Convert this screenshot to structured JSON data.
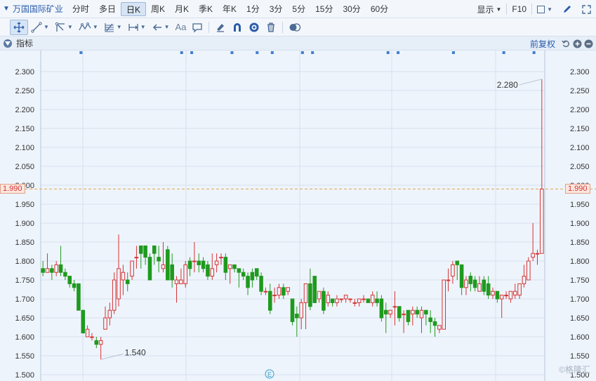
{
  "toolbar": {
    "stock_name": "万国国际矿业",
    "periods": [
      "分时",
      "多日",
      "日K",
      "周K",
      "月K",
      "季K",
      "年K",
      "1分",
      "3分",
      "5分",
      "15分",
      "30分",
      "60分"
    ],
    "active_period": "日K",
    "display_label": "显示",
    "f10_label": "F10"
  },
  "drawing_tools": {
    "text_tool_label": "Aa"
  },
  "indicator_bar": {
    "label": "指标",
    "adjust_label": "前复权"
  },
  "watermark": "©格隆汇",
  "colors": {
    "up": "#d53333",
    "down": "#1e9a1e",
    "accent": "#2a5caa",
    "current_line": "#e3a34a"
  },
  "chart_data": {
    "type": "candlestick",
    "y_ticks": [
      "2.300",
      "2.250",
      "2.200",
      "2.150",
      "2.100",
      "2.050",
      "2.000",
      "1.950",
      "1.900",
      "1.850",
      "1.800",
      "1.750",
      "1.700",
      "1.650",
      "1.600",
      "1.550",
      "1.500"
    ],
    "ylim": [
      1.5,
      2.3
    ],
    "current_price": 1.99,
    "current_price_label": "1.990",
    "annotations": [
      {
        "text": "2.280",
        "value": 2.28,
        "candle_index": 124
      },
      {
        "text": "1.540",
        "value": 1.54,
        "candle_index": 13
      }
    ],
    "event_marker": "E",
    "candles": [
      [
        1.78,
        1.77,
        1.8,
        1.76
      ],
      [
        1.77,
        1.78,
        1.82,
        1.77
      ],
      [
        1.78,
        1.77,
        1.79,
        1.75
      ],
      [
        1.77,
        1.79,
        1.8,
        1.76
      ],
      [
        1.79,
        1.77,
        1.84,
        1.76
      ],
      [
        1.77,
        1.76,
        1.78,
        1.75
      ],
      [
        1.76,
        1.74,
        1.76,
        1.73
      ],
      [
        1.74,
        1.73,
        1.75,
        1.72
      ],
      [
        1.74,
        1.67,
        1.74,
        1.67
      ],
      [
        1.67,
        1.61,
        1.67,
        1.61
      ],
      [
        1.6,
        1.62,
        1.63,
        1.6
      ],
      [
        1.6,
        1.6,
        1.61,
        1.59
      ],
      [
        1.59,
        1.58,
        1.6,
        1.57
      ],
      [
        1.58,
        1.59,
        1.6,
        1.54
      ],
      [
        1.62,
        1.65,
        1.68,
        1.62
      ],
      [
        1.65,
        1.67,
        1.69,
        1.63
      ],
      [
        1.67,
        1.75,
        1.77,
        1.66
      ],
      [
        1.7,
        1.78,
        1.87,
        1.68
      ],
      [
        1.75,
        1.77,
        1.79,
        1.71
      ],
      [
        1.75,
        1.74,
        1.77,
        1.72
      ],
      [
        1.76,
        1.8,
        1.8,
        1.75
      ],
      [
        1.81,
        1.81,
        1.84,
        1.78
      ],
      [
        1.84,
        1.82,
        1.84,
        1.78
      ],
      [
        1.84,
        1.81,
        1.84,
        1.79
      ],
      [
        1.81,
        1.75,
        1.82,
        1.75
      ],
      [
        1.84,
        1.82,
        1.84,
        1.79
      ],
      [
        1.81,
        1.8,
        1.84,
        1.77
      ],
      [
        1.78,
        1.79,
        1.85,
        1.77
      ],
      [
        1.83,
        1.75,
        1.84,
        1.75
      ],
      [
        1.79,
        1.75,
        1.82,
        1.73
      ],
      [
        1.74,
        1.75,
        1.76,
        1.69
      ],
      [
        1.74,
        1.75,
        1.78,
        1.74
      ],
      [
        1.74,
        1.79,
        1.8,
        1.73
      ],
      [
        1.8,
        1.78,
        1.81,
        1.76
      ],
      [
        1.8,
        1.8,
        1.85,
        1.77
      ],
      [
        1.8,
        1.79,
        1.82,
        1.77
      ],
      [
        1.8,
        1.78,
        1.81,
        1.77
      ],
      [
        1.79,
        1.76,
        1.8,
        1.75
      ],
      [
        1.76,
        1.78,
        1.82,
        1.75
      ],
      [
        1.79,
        1.8,
        1.82,
        1.77
      ],
      [
        1.81,
        1.81,
        1.82,
        1.79
      ],
      [
        1.81,
        1.77,
        1.82,
        1.75
      ],
      [
        1.78,
        1.79,
        1.79,
        1.74
      ],
      [
        1.79,
        1.78,
        1.79,
        1.77
      ],
      [
        1.78,
        1.77,
        1.78,
        1.73
      ],
      [
        1.77,
        1.76,
        1.78,
        1.75
      ],
      [
        1.76,
        1.73,
        1.77,
        1.71
      ],
      [
        1.77,
        1.75,
        1.78,
        1.73
      ],
      [
        1.78,
        1.76,
        1.78,
        1.75
      ],
      [
        1.76,
        1.72,
        1.77,
        1.71
      ],
      [
        1.72,
        1.72,
        1.73,
        1.71
      ],
      [
        1.72,
        1.67,
        1.74,
        1.66
      ],
      [
        1.71,
        1.71,
        1.73,
        1.69
      ],
      [
        1.71,
        1.73,
        1.74,
        1.7
      ],
      [
        1.73,
        1.71,
        1.74,
        1.7
      ],
      [
        1.72,
        1.73,
        1.73,
        1.71
      ],
      [
        1.7,
        1.64,
        1.7,
        1.63
      ],
      [
        1.66,
        1.65,
        1.68,
        1.6
      ],
      [
        1.65,
        1.69,
        1.7,
        1.62
      ],
      [
        1.69,
        1.74,
        1.74,
        1.62
      ],
      [
        1.74,
        1.68,
        1.78,
        1.67
      ],
      [
        1.76,
        1.69,
        1.76,
        1.69
      ],
      [
        1.7,
        1.72,
        1.72,
        1.69
      ],
      [
        1.72,
        1.67,
        1.73,
        1.66
      ],
      [
        1.69,
        1.71,
        1.72,
        1.68
      ],
      [
        1.7,
        1.69,
        1.7,
        1.68
      ],
      [
        1.69,
        1.7,
        1.71,
        1.68
      ],
      [
        1.7,
        1.7,
        1.7,
        1.69
      ],
      [
        1.7,
        1.71,
        1.71,
        1.69
      ],
      [
        1.7,
        1.7,
        1.7,
        1.69
      ],
      [
        1.69,
        1.69,
        1.7,
        1.68
      ],
      [
        1.69,
        1.7,
        1.7,
        1.68
      ],
      [
        1.7,
        1.7,
        1.71,
        1.69
      ],
      [
        1.7,
        1.69,
        1.7,
        1.69
      ],
      [
        1.69,
        1.71,
        1.72,
        1.68
      ],
      [
        1.7,
        1.69,
        1.72,
        1.68
      ],
      [
        1.7,
        1.65,
        1.71,
        1.64
      ],
      [
        1.67,
        1.66,
        1.69,
        1.61
      ],
      [
        1.66,
        1.67,
        1.67,
        1.65
      ],
      [
        1.68,
        1.68,
        1.72,
        1.63
      ],
      [
        1.68,
        1.65,
        1.68,
        1.64
      ],
      [
        1.66,
        1.66,
        1.67,
        1.61
      ],
      [
        1.67,
        1.64,
        1.67,
        1.63
      ],
      [
        1.66,
        1.67,
        1.68,
        1.63
      ],
      [
        1.67,
        1.66,
        1.68,
        1.65
      ],
      [
        1.65,
        1.67,
        1.68,
        1.61
      ],
      [
        1.67,
        1.66,
        1.67,
        1.63
      ],
      [
        1.65,
        1.64,
        1.67,
        1.61
      ],
      [
        1.64,
        1.63,
        1.65,
        1.6
      ],
      [
        1.62,
        1.63,
        1.63,
        1.61
      ],
      [
        1.62,
        1.75,
        1.75,
        1.62
      ],
      [
        1.75,
        1.75,
        1.78,
        1.72
      ],
      [
        1.76,
        1.79,
        1.8,
        1.74
      ],
      [
        1.8,
        1.79,
        1.8,
        1.75
      ],
      [
        1.79,
        1.73,
        1.79,
        1.71
      ],
      [
        1.73,
        1.75,
        1.76,
        1.71
      ],
      [
        1.76,
        1.74,
        1.77,
        1.72
      ],
      [
        1.75,
        1.73,
        1.76,
        1.72
      ],
      [
        1.72,
        1.74,
        1.76,
        1.72
      ],
      [
        1.75,
        1.72,
        1.76,
        1.71
      ],
      [
        1.74,
        1.71,
        1.76,
        1.7
      ],
      [
        1.71,
        1.72,
        1.73,
        1.7
      ],
      [
        1.72,
        1.7,
        1.72,
        1.69
      ],
      [
        1.7,
        1.71,
        1.71,
        1.65
      ],
      [
        1.71,
        1.71,
        1.72,
        1.7
      ],
      [
        1.7,
        1.72,
        1.72,
        1.69
      ],
      [
        1.71,
        1.72,
        1.74,
        1.7
      ],
      [
        1.71,
        1.74,
        1.74,
        1.7
      ],
      [
        1.74,
        1.76,
        1.79,
        1.73
      ],
      [
        1.75,
        1.8,
        1.81,
        1.75
      ],
      [
        1.81,
        1.82,
        1.9,
        1.8
      ],
      [
        1.82,
        1.82,
        1.83,
        1.79
      ],
      [
        1.82,
        1.99,
        2.28,
        1.82
      ]
    ],
    "volumes": [],
    "grid": true,
    "legend": "none"
  }
}
